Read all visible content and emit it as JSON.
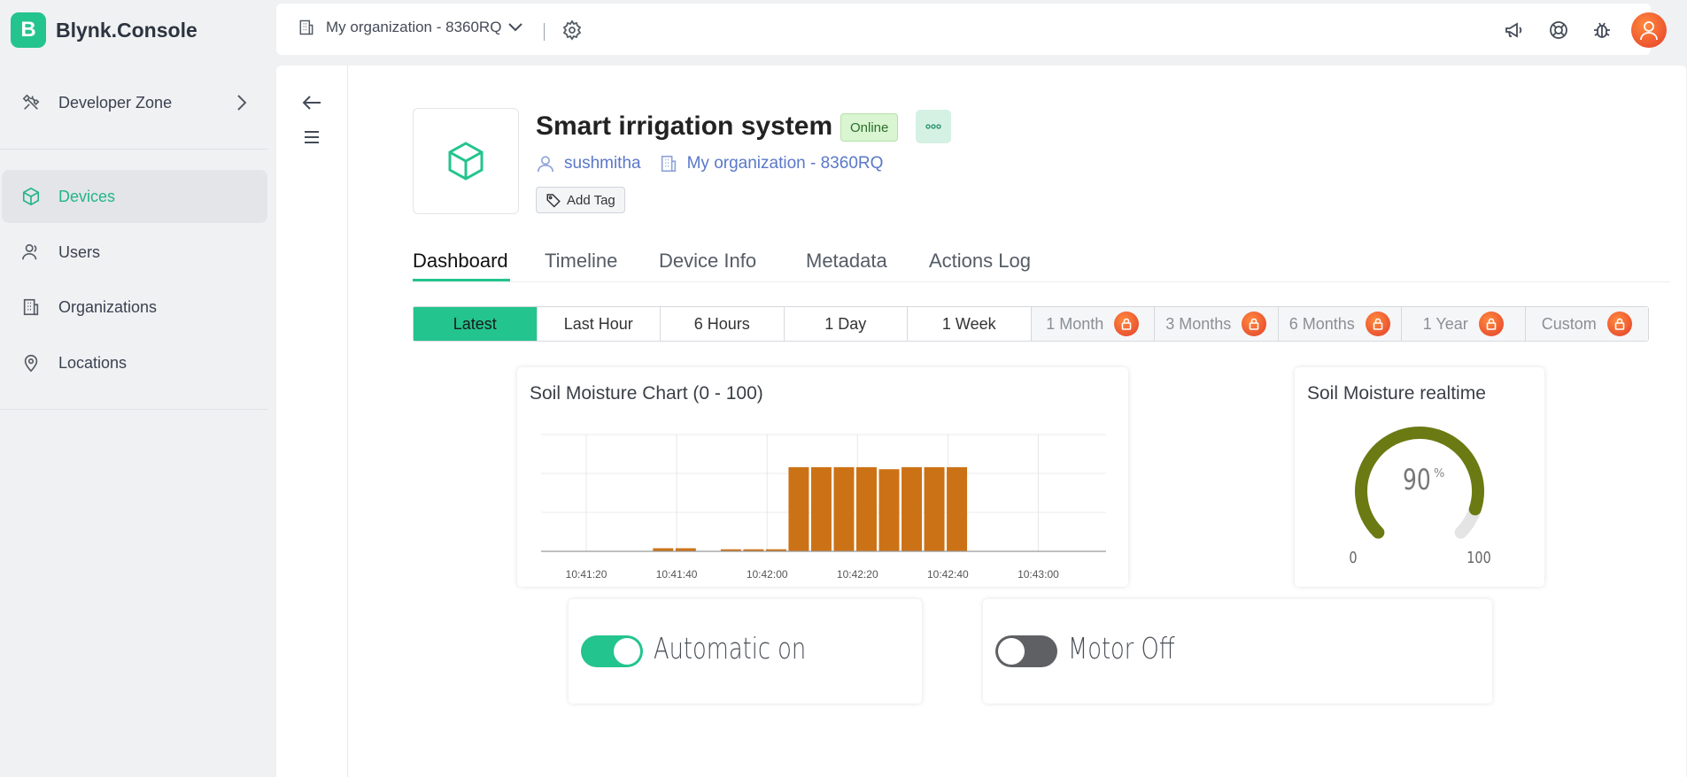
{
  "brand": {
    "logo_letter": "B",
    "name": "Blynk.Console",
    "accent": "#23c48e"
  },
  "sidebar": {
    "developer_zone": "Developer Zone",
    "items": [
      {
        "label": "Devices",
        "icon": "cube-icon",
        "active": true
      },
      {
        "label": "Users",
        "icon": "users-icon",
        "active": false
      },
      {
        "label": "Organizations",
        "icon": "building-icon",
        "active": false
      },
      {
        "label": "Locations",
        "icon": "map-pin-icon",
        "active": false
      }
    ]
  },
  "topbar": {
    "organization": "My organization - 8360RQ",
    "icons": [
      "megaphone-icon",
      "lifebuoy-icon",
      "bug-icon",
      "avatar"
    ]
  },
  "device": {
    "title": "Smart irrigation system",
    "status": "Online",
    "owner": "sushmitha",
    "organization": "My organization - 8360RQ",
    "add_tag": "Add Tag"
  },
  "tabs": [
    "Dashboard",
    "Timeline",
    "Device Info",
    "Metadata",
    "Actions Log"
  ],
  "active_tab": "Dashboard",
  "time_ranges": [
    {
      "label": "Latest",
      "active": true,
      "locked": false
    },
    {
      "label": "Last Hour",
      "active": false,
      "locked": false
    },
    {
      "label": "6 Hours",
      "active": false,
      "locked": false
    },
    {
      "label": "1 Day",
      "active": false,
      "locked": false
    },
    {
      "label": "1 Week",
      "active": false,
      "locked": false
    },
    {
      "label": "1 Month",
      "active": false,
      "locked": true
    },
    {
      "label": "3 Months",
      "active": false,
      "locked": true
    },
    {
      "label": "6 Months",
      "active": false,
      "locked": true
    },
    {
      "label": "1 Year",
      "active": false,
      "locked": true
    },
    {
      "label": "Custom",
      "active": false,
      "locked": true
    }
  ],
  "widgets": {
    "chart_title": "Soil Moisture Chart (0 - 100)",
    "gauge_title": "Soil Moisture realtime",
    "gauge_value": "90",
    "gauge_unit": "%",
    "gauge_min": "0",
    "gauge_max": "100",
    "gauge_color": "#6b7a12",
    "automatic_label": "Automatic on",
    "automatic_on": true,
    "motor_label": "Motor Off",
    "motor_on": false
  },
  "chart_data": {
    "type": "bar",
    "title": "Soil Moisture Chart (0 - 100)",
    "color": "#cc7216",
    "x_ticks": [
      "10:41:20",
      "10:41:40",
      "10:42:00",
      "10:42:20",
      "10:42:40",
      "10:43:00"
    ],
    "x_range_seconds": [
      0,
      125
    ],
    "ylim": [
      0,
      100
    ],
    "bars": [
      {
        "t": 27,
        "value": 3
      },
      {
        "t": 32,
        "value": 3
      },
      {
        "t": 42,
        "value": 2
      },
      {
        "t": 47,
        "value": 2
      },
      {
        "t": 52,
        "value": 2
      },
      {
        "t": 57,
        "value": 82
      },
      {
        "t": 62,
        "value": 82
      },
      {
        "t": 67,
        "value": 82
      },
      {
        "t": 72,
        "value": 82
      },
      {
        "t": 77,
        "value": 80
      },
      {
        "t": 82,
        "value": 82
      },
      {
        "t": 87,
        "value": 82
      },
      {
        "t": 92,
        "value": 82
      }
    ]
  }
}
